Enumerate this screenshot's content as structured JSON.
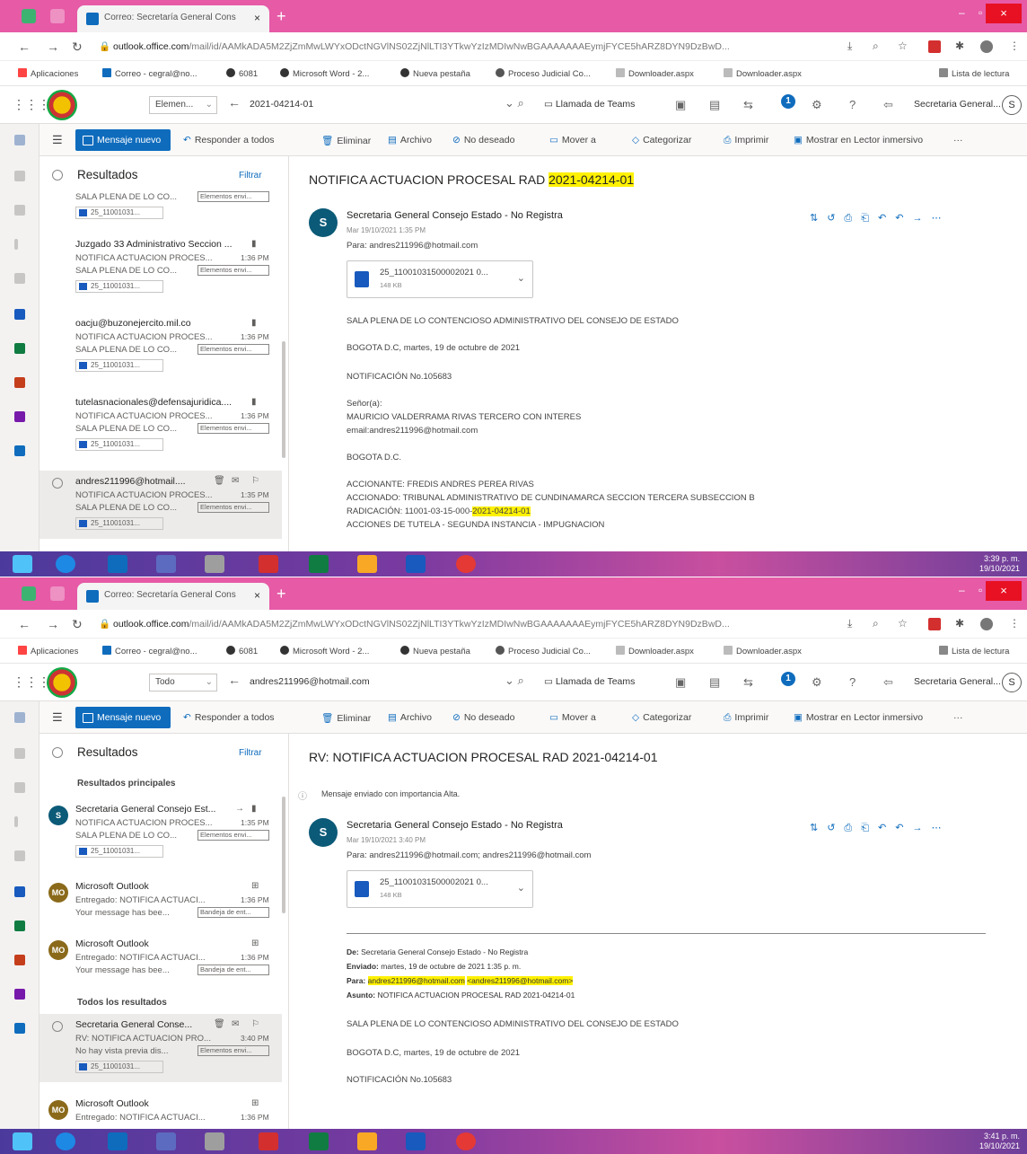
{
  "browser": {
    "tab_title": "Correo: Secretaría General Cons",
    "tab_close": "×",
    "new_tab": "+",
    "url_domain": "outlook.office.com",
    "url_path": "/mail/id/AAMkADA5M2ZjZmMwLWYxODctNGVlNS02ZjNlLTI3YTkwYzIzMDIwNwBGAAAAAAAEymjFYCE5hARZ8DYN9DzBwD...",
    "bookmarks": [
      "Aplicaciones",
      "Correo - cegral@no...",
      "6081",
      "Microsoft Word - 2...",
      "Nueva pestaña",
      "Proceso Judicial Co...",
      "Downloader.aspx",
      "Downloader.aspx",
      "Lista de lectura"
    ]
  },
  "outlook": {
    "teams_call": "Llamada de Teams",
    "account": "Secretaria General...",
    "avatar_letter": "S",
    "notification_count": "1",
    "new_message": "Mensaje nuevo",
    "commands": [
      "Responder a todos",
      "Eliminar",
      "Archivo",
      "No deseado",
      "Mover a",
      "Categorizar",
      "Imprimir",
      "Mostrar en Lector inmersivo",
      "···"
    ],
    "results_label": "Resultados",
    "filter_label": "Filtrar"
  },
  "shot1": {
    "scope": "Elemen...",
    "query": "2021-04214-01",
    "items": [
      {
        "from": "",
        "subject": "SALA PLENA DE LO CO...",
        "time": "",
        "preview": "",
        "category": "Elementos envi...",
        "attachment": "25_11001031..."
      },
      {
        "from": "Juzgado 33 Administrativo Seccion ...",
        "subject": "NOTIFICA ACTUACION PROCES...",
        "time": "1:36 PM",
        "preview": "SALA PLENA DE LO CO...",
        "category": "Elementos envi...",
        "attachment": "25_11001031..."
      },
      {
        "from": "oacju@buzonejercito.mil.co",
        "subject": "NOTIFICA ACTUACION PROCES...",
        "time": "1:36 PM",
        "preview": "SALA PLENA DE LO CO...",
        "category": "Elementos envi...",
        "attachment": "25_11001031..."
      },
      {
        "from": "tutelasnacionales@defensajuridica....",
        "subject": "NOTIFICA ACTUACION PROCES...",
        "time": "1:36 PM",
        "preview": "SALA PLENA DE LO CO...",
        "category": "Elementos envi...",
        "attachment": "25_11001031..."
      },
      {
        "from": "andres211996@hotmail....",
        "subject": "NOTIFICA ACTUACION PROCES...",
        "time": "1:35 PM",
        "preview": "SALA PLENA DE LO CO...",
        "category": "Elementos envi...",
        "attachment": "25_11001031..."
      }
    ],
    "title_prefix": "NOTIFICA ACTUACION PROCESAL RAD ",
    "title_highlight": "2021-04214-01",
    "sender": "Secretaria General Consejo Estado - No Registra",
    "date": "Mar 19/10/2021 1:35 PM",
    "to": "Para: andres211996@hotmail.com",
    "att_name": "25_11001031500002021 0...",
    "att_size": "148 KB",
    "body": [
      "SALA PLENA DE LO CONTENCIOSO ADMINISTRATIVO DEL CONSEJO DE ESTADO",
      "BOGOTA D.C, martes, 19 de octubre de 2021",
      "NOTIFICACIÓN No.105683",
      "Señor(a):",
      "MAURICIO VALDERRAMA RIVAS  TERCERO CON INTERES",
      "email:andres211996@hotmail.com",
      "BOGOTA D.C.",
      "ACCIONANTE: FREDIS ANDRES PEREA RIVAS",
      "ACCIONADO: TRIBUNAL ADMINISTRATIVO DE CUNDINAMARCA SECCION TERCERA SUBSECCION B",
      "RADICACIÓN: 11001-03-15-000-",
      "ACCIONES DE TUTELA - SEGUNDA INSTANCIA - IMPUGNACION"
    ],
    "rad_highlight": "2021-04214-01",
    "clock_time": "3:39 p. m.",
    "clock_date": "19/10/2021"
  },
  "shot2": {
    "scope": "Todo",
    "query": "andres211996@hotmail.com",
    "top_results_label": "Resultados principales",
    "all_results_label": "Todos los resultados",
    "items": [
      {
        "av": "S",
        "from": "Secretaria General Consejo Est...",
        "subject": "NOTIFICA ACTUACION PROCES...",
        "time": "1:35 PM",
        "preview": "SALA PLENA DE LO CO...",
        "category": "Elementos envi...",
        "attachment": "25_11001031..."
      },
      {
        "av": "MO",
        "from": "Microsoft Outlook",
        "subject": "Entregado: NOTIFICA ACTUACI...",
        "time": "1:36 PM",
        "preview": "Your message has bee...",
        "category": "Bandeja de ent...",
        "attachment": ""
      },
      {
        "av": "MO",
        "from": "Microsoft Outlook",
        "subject": "Entregado: NOTIFICA ACTUACI...",
        "time": "1:36 PM",
        "preview": "Your message has bee...",
        "category": "Bandeja de ent...",
        "attachment": ""
      },
      {
        "av": "",
        "from": "Secretaria General Conse...",
        "subject": "RV: NOTIFICA ACTUACION PRO...",
        "time": "3:40 PM",
        "preview": "No hay vista previa dis...",
        "category": "Elementos envi...",
        "attachment": "25_11001031..."
      },
      {
        "av": "MO",
        "from": "Microsoft Outlook",
        "subject": "Entregado: NOTIFICA ACTUACI...",
        "time": "1:36 PM",
        "preview": "",
        "category": "",
        "attachment": ""
      }
    ],
    "title": "RV: NOTIFICA ACTUACION PROCESAL RAD 2021-04214-01",
    "importance": "Mensaje enviado con importancia Alta.",
    "sender": "Secretaria General Consejo Estado - No Registra",
    "date": "Mar 19/10/2021 3:40 PM",
    "to": "Para: andres211996@hotmail.com; andres211996@hotmail.com",
    "att_name": "25_11001031500002021 0...",
    "att_size": "148 KB",
    "fw_from_label": "De:",
    "fw_from": "Secretaria General Consejo Estado - No Registra",
    "fw_sent_label": "Enviado:",
    "fw_sent": "martes, 19 de octubre de 2021 1:35 p. m.",
    "fw_to_label": "Para:",
    "fw_to_1": "andres211996@hotmail.com",
    "fw_to_2": "<andres211996@hotmail.com>",
    "fw_subject_label": "Asunto:",
    "fw_subject": "NOTIFICA ACTUACION PROCESAL RAD 2021-04214-01",
    "body": [
      "SALA PLENA DE LO CONTENCIOSO ADMINISTRATIVO DEL CONSEJO DE ESTADO",
      "BOGOTA D.C, martes, 19 de octubre de 2021",
      "NOTIFICACIÓN No.105683"
    ],
    "clock_time": "3:41 p. m.",
    "clock_date": "19/10/2021"
  }
}
